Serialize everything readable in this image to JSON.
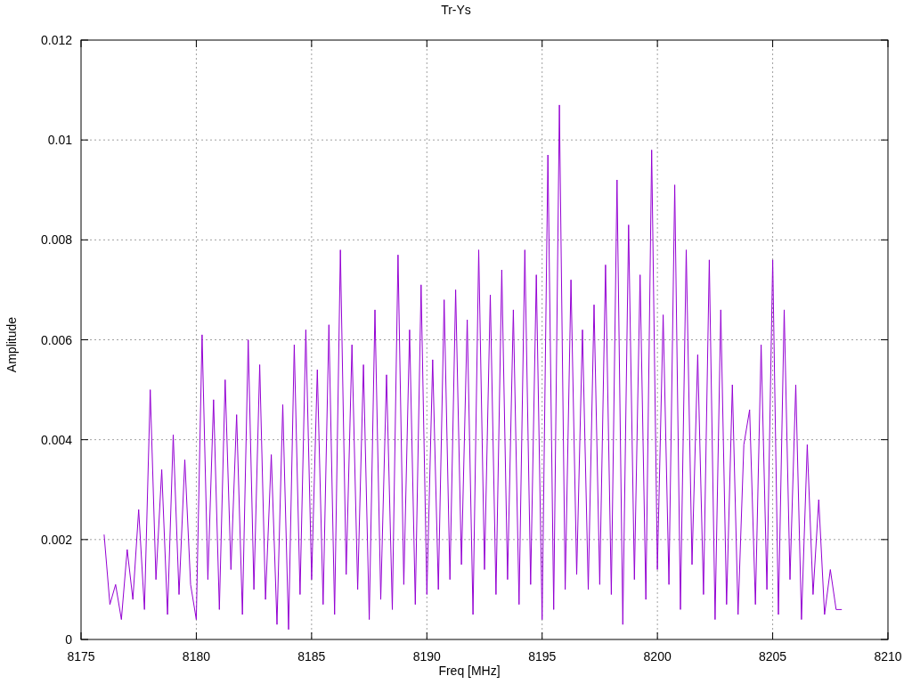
{
  "chart_data": {
    "type": "line",
    "title": "Tr-Ys",
    "xlabel": "Freq [MHz]",
    "ylabel": "Amplitude",
    "xlim": [
      8175,
      8210
    ],
    "ylim": [
      0,
      0.012
    ],
    "xticks": [
      8175,
      8180,
      8185,
      8190,
      8195,
      8200,
      8205,
      8210
    ],
    "yticks": [
      {
        "value": 0,
        "label": "0"
      },
      {
        "value": 0.002,
        "label": "0.002"
      },
      {
        "value": 0.004,
        "label": "0.004"
      },
      {
        "value": 0.006,
        "label": "0.006"
      },
      {
        "value": 0.008,
        "label": "0.008"
      },
      {
        "value": 0.01,
        "label": "0.01"
      },
      {
        "value": 0.012,
        "label": "0.012"
      }
    ],
    "x": [
      8176,
      8176.25,
      8176.5,
      8176.75,
      8177,
      8177.25,
      8177.5,
      8177.75,
      8178,
      8178.25,
      8178.5,
      8178.75,
      8179,
      8179.25,
      8179.5,
      8179.75,
      8180,
      8180.25,
      8180.5,
      8180.75,
      8181,
      8181.25,
      8181.5,
      8181.75,
      8182,
      8182.25,
      8182.5,
      8182.75,
      8183,
      8183.25,
      8183.5,
      8183.75,
      8184,
      8184.25,
      8184.5,
      8184.75,
      8185,
      8185.25,
      8185.5,
      8185.75,
      8186,
      8186.25,
      8186.5,
      8186.75,
      8187,
      8187.25,
      8187.5,
      8187.75,
      8188,
      8188.25,
      8188.5,
      8188.75,
      8189,
      8189.25,
      8189.5,
      8189.75,
      8190,
      8190.25,
      8190.5,
      8190.75,
      8191,
      8191.25,
      8191.5,
      8191.75,
      8192,
      8192.25,
      8192.5,
      8192.75,
      8193,
      8193.25,
      8193.5,
      8193.75,
      8194,
      8194.25,
      8194.5,
      8194.75,
      8195,
      8195.25,
      8195.5,
      8195.75,
      8196,
      8196.25,
      8196.5,
      8196.75,
      8197,
      8197.25,
      8197.5,
      8197.75,
      8198,
      8198.25,
      8198.5,
      8198.75,
      8199,
      8199.25,
      8199.5,
      8199.75,
      8200,
      8200.25,
      8200.5,
      8200.75,
      8201,
      8201.25,
      8201.5,
      8201.75,
      8202,
      8202.25,
      8202.5,
      8202.75,
      8203,
      8203.25,
      8203.5,
      8203.75,
      8204,
      8204.25,
      8204.5,
      8204.75,
      8205,
      8205.25,
      8205.5,
      8205.75,
      8206,
      8206.25,
      8206.5,
      8206.75,
      8207,
      8207.25,
      8207.5,
      8207.75,
      8208
    ],
    "grid": true,
    "series": [
      {
        "color": "#9400d3",
        "values": [
          0.0021,
          0.0007,
          0.0011,
          0.0004,
          0.0018,
          0.0008,
          0.0026,
          0.0006,
          0.005,
          0.0012,
          0.0034,
          0.0005,
          0.0041,
          0.0009,
          0.0036,
          0.0011,
          0.0004,
          0.0061,
          0.0012,
          0.0048,
          0.0006,
          0.0052,
          0.0014,
          0.0045,
          0.0005,
          0.006,
          0.001,
          0.0055,
          0.0008,
          0.0037,
          0.0003,
          0.0047,
          0.0002,
          0.0059,
          0.0009,
          0.0062,
          0.0012,
          0.0054,
          0.0007,
          0.0063,
          0.0005,
          0.0078,
          0.0013,
          0.0059,
          0.001,
          0.0055,
          0.0004,
          0.0066,
          0.0008,
          0.0053,
          0.0006,
          0.0077,
          0.0011,
          0.0062,
          0.0007,
          0.0071,
          0.0009,
          0.0056,
          0.001,
          0.0068,
          0.0012,
          0.007,
          0.0015,
          0.0064,
          0.0005,
          0.0078,
          0.0014,
          0.0069,
          0.0009,
          0.0074,
          0.0012,
          0.0066,
          0.0007,
          0.0078,
          0.0011,
          0.0073,
          0.0004,
          0.0097,
          0.0006,
          0.0107,
          0.001,
          0.0072,
          0.0013,
          0.0062,
          0.001,
          0.0067,
          0.0011,
          0.0075,
          0.0009,
          0.0092,
          0.0003,
          0.0083,
          0.0012,
          0.0073,
          0.0008,
          0.0098,
          0.0014,
          0.0065,
          0.0011,
          0.0091,
          0.0006,
          0.0078,
          0.0015,
          0.0057,
          0.0009,
          0.0076,
          0.0004,
          0.0066,
          0.0007,
          0.0051,
          0.0005,
          0.0039,
          0.0046,
          0.0007,
          0.0059,
          0.001,
          0.0076,
          0.0005,
          0.0066,
          0.0012,
          0.0051,
          0.0004,
          0.0039,
          0.0009,
          0.0028,
          0.0005,
          0.0014,
          0.0006,
          0.0006
        ]
      }
    ]
  }
}
